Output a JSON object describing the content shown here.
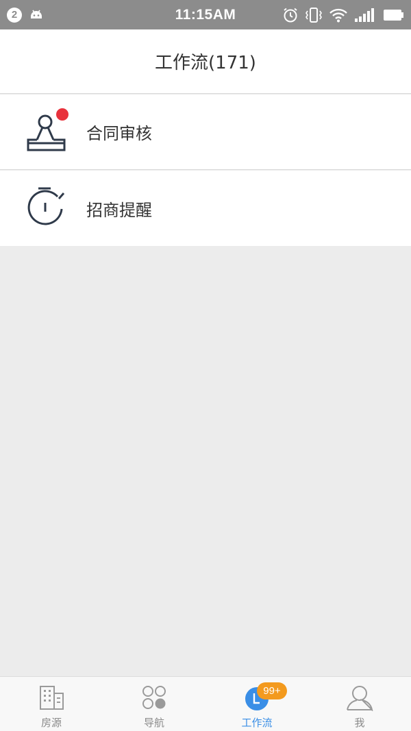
{
  "status_bar": {
    "notification_count": "2",
    "time": "11:15AM",
    "icons": [
      "android-icon",
      "alarm-icon",
      "vibrate-icon",
      "wifi-icon",
      "signal-icon",
      "battery-icon"
    ]
  },
  "header": {
    "title": "工作流(171)"
  },
  "list": {
    "items": [
      {
        "label": "合同审核",
        "icon": "stamp-icon",
        "has_unread_dot": true
      },
      {
        "label": "招商提醒",
        "icon": "stopwatch-icon",
        "has_unread_dot": false
      }
    ]
  },
  "tab_bar": {
    "tabs": [
      {
        "label": "房源",
        "icon": "building-icon",
        "active": false
      },
      {
        "label": "导航",
        "icon": "grid-circles-icon",
        "active": false
      },
      {
        "label": "工作流",
        "icon": "workflow-icon",
        "active": true,
        "badge": "99+"
      },
      {
        "label": "我",
        "icon": "user-icon",
        "active": false
      }
    ]
  },
  "colors": {
    "status_bar_bg": "#8c8c8c",
    "accent_blue": "#3a8ee6",
    "badge_orange": "#f39a1e",
    "unread_red": "#e8323c",
    "background_gray": "#ececec"
  }
}
